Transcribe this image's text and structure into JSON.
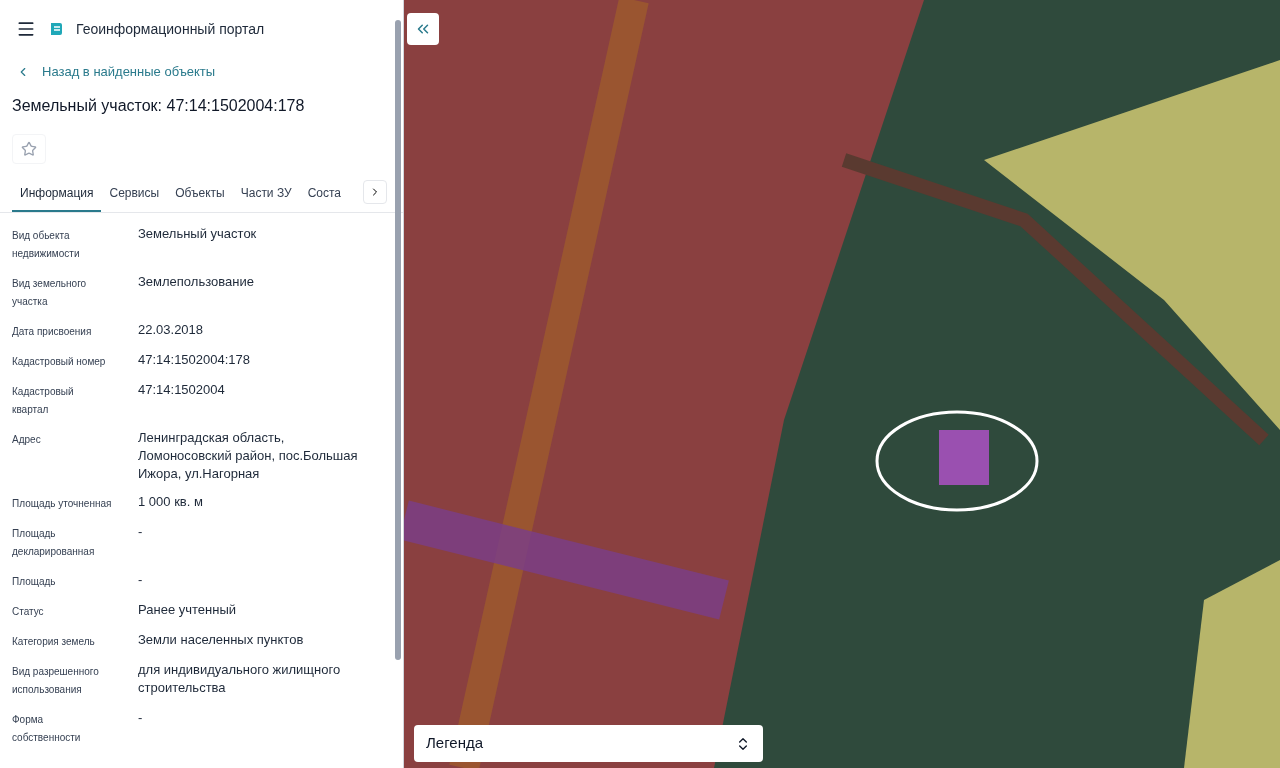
{
  "header": {
    "title": "Геоинформационный портал"
  },
  "back_link": "Назад в найденные объекты",
  "object_title": "Земельный участок: 47:14:1502004:178",
  "favorite": {
    "on": false
  },
  "tabs": [
    {
      "label": "Информация",
      "selected": true
    },
    {
      "label": "Сервисы",
      "selected": false
    },
    {
      "label": "Объекты",
      "selected": false
    },
    {
      "label": "Части ЗУ",
      "selected": false
    },
    {
      "label": "Соста",
      "selected": false
    }
  ],
  "properties": [
    {
      "label": "Вид обьекта недвижимости",
      "value": "Земельный участок"
    },
    {
      "label": "Вид земельного участка",
      "value": "Землепользование"
    },
    {
      "label": "Дата присвоения",
      "value": "22.03.2018"
    },
    {
      "label": "Кадастровый номер",
      "value": "47:14:1502004:178"
    },
    {
      "label": "Кадастровый квартал",
      "value": "47:14:1502004"
    },
    {
      "label": "Адрес",
      "value": "Ленинградская область, Ломоносовский район, пос.Большая Ижора, ул.Нагорная"
    },
    {
      "label": "Площадь уточненная",
      "value": "1 000 кв. м"
    },
    {
      "label": "Площадь декларированная",
      "value": "-"
    },
    {
      "label": "Площадь",
      "value": "-"
    },
    {
      "label": "Статус",
      "value": "Ранее учтенный"
    },
    {
      "label": "Категория земель",
      "value": "Земли населенных пунктов"
    },
    {
      "label": "Вид разрешенного использования",
      "value": "для индивидуального жилищного строительства"
    },
    {
      "label": "Форма собственности",
      "value": "-"
    }
  ],
  "legend": {
    "label": "Легенда"
  }
}
